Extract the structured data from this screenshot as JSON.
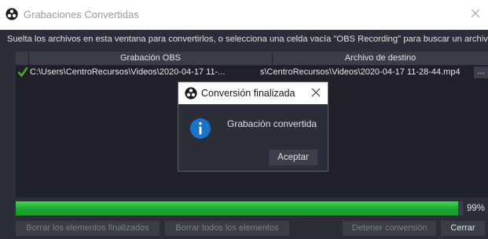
{
  "window": {
    "title": "Grabaciones Convertidas",
    "instructions": "Suelta los archivos en esta ventana para convertirlos, o selecciona una celda vacía \"OBS Recording\" para buscar un archivo."
  },
  "table": {
    "columns": [
      "Grabación OBS",
      "Archivo de destino"
    ],
    "rows": [
      {
        "status": "check-icon",
        "source": "C:\\Users\\CentroRecursos\\Videos\\2020-04-17 11-...",
        "destination": "s\\CentroRecursos\\Videos\\2020-04-17 11-28-44.mp4",
        "browse_label": "..."
      }
    ]
  },
  "dialog": {
    "title": "Conversión finalizada",
    "message": "Grabación convertida",
    "ok_label": "Aceptar",
    "icon": "info-icon"
  },
  "progress": {
    "value": 0.99,
    "label": "99%"
  },
  "buttons": {
    "remove_finished": "Borrar los elementos finalizados",
    "remove_all": "Borrar todos los elementos",
    "stop": "Detener conversión",
    "close": "Cerrar"
  },
  "colors": {
    "progress": "#1ea430",
    "info": "#1a73c7",
    "check": "#4caf2f"
  }
}
